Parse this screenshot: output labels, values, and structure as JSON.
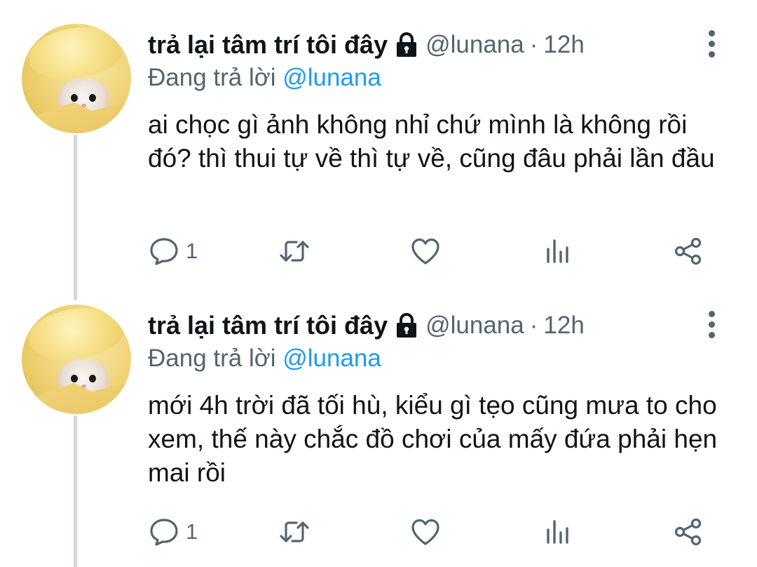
{
  "tweets": [
    {
      "display_name": "trả lại tâm trí tôi đây",
      "handle": "@lunana",
      "separator": "·",
      "time": "12h",
      "reply_prefix": "Đang trả lời",
      "reply_to": "@lunana",
      "text": "ai chọc gì ảnh không nhỉ chứ mình là không rồi đó? thì thui tự về thì tự về, cũng đâu phải lần đầu",
      "reply_count": "1"
    },
    {
      "display_name": "trả lại tâm trí tôi đây",
      "handle": "@lunana",
      "separator": "·",
      "time": "12h",
      "reply_prefix": "Đang trả lời",
      "reply_to": "@lunana",
      "text": "mới 4h trời đã tối hù, kiểu gì tẹo cũng mưa to cho xem, thế này chắc đồ chơi của mấy đứa phải hẹn mai rồi",
      "reply_count": "1"
    }
  ],
  "icons": {
    "lock": "lock-icon",
    "more": "more-vertical-icon",
    "reply": "reply-icon",
    "retweet": "retweet-icon",
    "like": "heart-icon",
    "views": "views-icon",
    "share": "share-icon"
  },
  "colors": {
    "text": "#0f1419",
    "secondary": "#536471",
    "mention": "#1d9bf0",
    "thread_line": "#cfd9de"
  }
}
